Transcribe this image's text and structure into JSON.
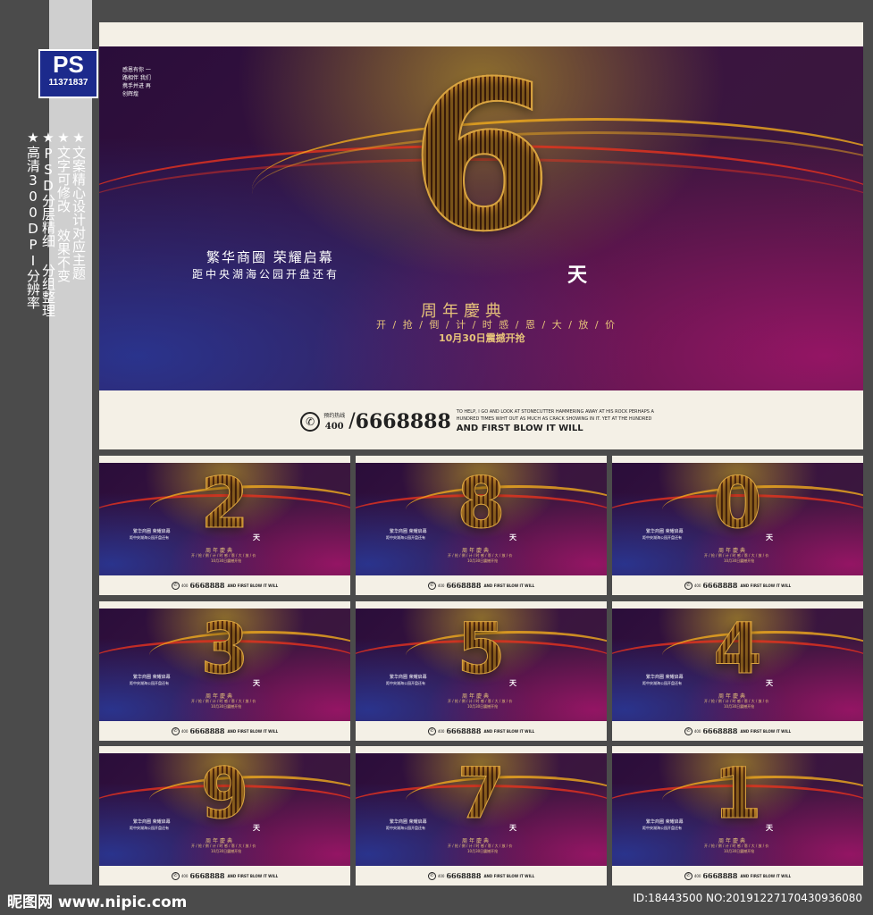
{
  "badge": {
    "logo": "PS",
    "id": "11371837"
  },
  "features": [
    "★文案精心设计对应主题",
    "★文字可修改 效果不变",
    "★PSD分层精细 分组整理",
    "★高清300DPI分辨率"
  ],
  "poster": {
    "corner_text": "感恩有你 一路相伴 我们携手并进 再创辉煌",
    "digit": "6",
    "unit": "天",
    "headline": "繁华商圈  荣耀启幕",
    "subline": "距中央湖海公园开盘还有",
    "title": "周年慶典",
    "slogan": "开 / 抢 / 倒 / 计 / 时  感 / 恩 / 大 / 放 / 价",
    "date": "10月30日震撼开抢",
    "hotline_label": "预约热线",
    "hotline_prefix": "400",
    "phone": "6668888",
    "quote": "TO HELP, I GO AND LOOK AT STONECUTTER HAMMERING AWAY AT HIS ROCK PERHAPS A HUNDRED TIMES WIHT OUT AS MUCH AS CRACK SHOWING IN IT. YET AT THE HUNDRED",
    "tagline": "AND FIRST BLOW IT WILL"
  },
  "thumbnails": [
    "2",
    "8",
    "0",
    "3",
    "5",
    "4",
    "9",
    "7",
    "1"
  ],
  "footer": {
    "site": "昵图网 www.nipic.com",
    "id": "ID:18443500 NO:20191227170430936080"
  },
  "colors": {
    "gold": "#d9a441",
    "badge": "#1c2a8c",
    "background": "#4b4b4b"
  }
}
